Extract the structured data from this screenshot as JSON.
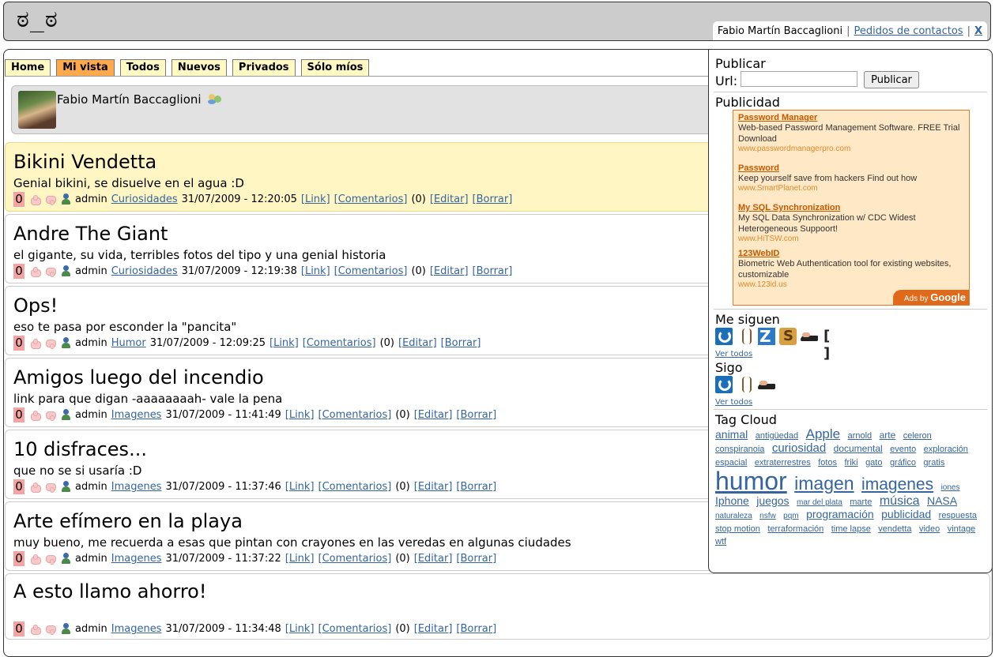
{
  "header": {
    "logo": "ಠ_ಠ",
    "user_name": "Fabio Martín Baccaglioni",
    "contacts_link": "Pedidos de contactos",
    "separator": "|",
    "close_label": "X"
  },
  "tabs": [
    {
      "label": "Home",
      "active": false
    },
    {
      "label": "Mi vista",
      "active": true
    },
    {
      "label": "Todos",
      "active": false
    },
    {
      "label": "Nuevos",
      "active": false
    },
    {
      "label": "Privados",
      "active": false
    },
    {
      "label": "Sólo míos",
      "active": false
    }
  ],
  "profile": {
    "name": "Fabio Martín Baccaglioni"
  },
  "posts": [
    {
      "title": "Bikini Vendetta",
      "desc": "Genial bikini, se disuelve en el agua :D",
      "votes": "0",
      "author": "admin",
      "category": "Curiosidades",
      "date": "31/07/2009 - 12:20:05",
      "link": "[Link]",
      "comments": "[Comentarios]",
      "count": "(0)",
      "edit": "[Editar]",
      "delete": "[Borrar]"
    },
    {
      "title": "Andre The Giant",
      "desc": "el gigante, su vida, terribles fotos del tipo y una genial historia",
      "votes": "0",
      "author": "admin",
      "category": "Curiosidades",
      "date": "31/07/2009 - 12:19:38",
      "link": "[Link]",
      "comments": "[Comentarios]",
      "count": "(0)",
      "edit": "[Editar]",
      "delete": "[Borrar]"
    },
    {
      "title": "Ops!",
      "desc": "eso te pasa por esconder la \"pancita\"",
      "votes": "0",
      "author": "admin",
      "category": "Humor",
      "date": "31/07/2009 - 12:09:25",
      "link": "[Link]",
      "comments": "[Comentarios]",
      "count": "(0)",
      "edit": "[Editar]",
      "delete": "[Borrar]"
    },
    {
      "title": "Amigos luego del incendio",
      "desc": "link para que digan -aaaaaaaah- vale la pena",
      "votes": "0",
      "author": "admin",
      "category": "Imagenes",
      "date": "31/07/2009 - 11:41:49",
      "link": "[Link]",
      "comments": "[Comentarios]",
      "count": "(0)",
      "edit": "[Editar]",
      "delete": "[Borrar]"
    },
    {
      "title": "10 disfraces...",
      "desc": "que no se si usaría :D",
      "votes": "0",
      "author": "admin",
      "category": "Imagenes",
      "date": "31/07/2009 - 11:37:46",
      "link": "[Link]",
      "comments": "[Comentarios]",
      "count": "(0)",
      "edit": "[Editar]",
      "delete": "[Borrar]"
    },
    {
      "title": "Arte efímero en la playa",
      "desc": "muy bueno, me recuerda a esas que pintan con crayones en las veredas en algunas ciudades",
      "votes": "0",
      "author": "admin",
      "category": "Imagenes",
      "date": "31/07/2009 - 11:37:22",
      "link": "[Link]",
      "comments": "[Comentarios]",
      "count": "(0)",
      "edit": "[Editar]",
      "delete": "[Borrar]"
    },
    {
      "title": "A esto llamo ahorro!",
      "desc": "",
      "votes": "0",
      "author": "admin",
      "category": "Imagenes",
      "date": "31/07/2009 - 11:34:48",
      "link": "[Link]",
      "comments": "[Comentarios]",
      "count": "(0)",
      "edit": "[Editar]",
      "delete": "[Borrar]"
    }
  ],
  "sidebar": {
    "publish_heading": "Publicar",
    "url_label": "Url:",
    "url_value": "",
    "publish_button": "Publicar",
    "ads_heading": "Publicidad",
    "ads": [
      {
        "title": "Password Manager",
        "text": "Web-based Password Management Software. FREE Trial Download",
        "url": "www.passwordmanagerpro.com"
      },
      {
        "title": "Password",
        "text": "Keep yourself save from hackers Find out how",
        "url": "www.SmartPlanet.com"
      },
      {
        "title": "My SQL Synchronization",
        "text": "My SQL Data Synchronization w/ CDC Widest Heterogeneous Suppoort!",
        "url": "www.HiTSW.com"
      },
      {
        "title": "123WebID",
        "text": "Biometric Web Authentication tool for existing websites, customizable",
        "url": "www.123id.us"
      }
    ],
    "adsby_prefix": "Ads by",
    "adsby_brand": "Google",
    "followers_heading": "Me siguen",
    "following_heading": "Sigo",
    "see_all": "Ver todos",
    "tag_heading": "Tag Cloud",
    "tags": [
      {
        "t": "animal",
        "s": 14
      },
      {
        "t": "antigüedad",
        "s": 11
      },
      {
        "t": "Apple",
        "s": 17
      },
      {
        "t": "arnold",
        "s": 11
      },
      {
        "t": "arte",
        "s": 12
      },
      {
        "t": "celeron",
        "s": 11
      },
      {
        "t": "conspiranoia",
        "s": 11
      },
      {
        "t": "curiosidad",
        "s": 15
      },
      {
        "t": "documental",
        "s": 12
      },
      {
        "t": "evento",
        "s": 11
      },
      {
        "t": "exploración",
        "s": 11
      },
      {
        "t": "espacial",
        "s": 11
      },
      {
        "t": "extraterrestres",
        "s": 11
      },
      {
        "t": "fotos",
        "s": 11
      },
      {
        "t": "friki",
        "s": 11
      },
      {
        "t": "gato",
        "s": 11
      },
      {
        "t": "gráfico",
        "s": 11
      },
      {
        "t": "gratis",
        "s": 11
      },
      {
        "t": "humor",
        "s": 32
      },
      {
        "t": "imagen",
        "s": 23
      },
      {
        "t": "imagenes",
        "s": 21
      },
      {
        "t": "iones",
        "s": 10
      },
      {
        "t": "Iphone",
        "s": 14
      },
      {
        "t": "juegos",
        "s": 14
      },
      {
        "t": "mar del plata",
        "s": 10
      },
      {
        "t": "marte",
        "s": 11
      },
      {
        "t": "música",
        "s": 16
      },
      {
        "t": "NASA",
        "s": 14
      },
      {
        "t": "naturaleza",
        "s": 10
      },
      {
        "t": "nsfw",
        "s": 10
      },
      {
        "t": "pqm",
        "s": 10
      },
      {
        "t": "programación",
        "s": 14
      },
      {
        "t": "publicidad",
        "s": 14
      },
      {
        "t": "respuesta",
        "s": 11
      },
      {
        "t": "stop motion",
        "s": 11
      },
      {
        "t": "terraformación",
        "s": 11
      },
      {
        "t": "time lapse",
        "s": 11
      },
      {
        "t": "vendetta",
        "s": 11
      },
      {
        "t": "video",
        "s": 11
      },
      {
        "t": "vintage",
        "s": 11
      },
      {
        "t": "wtf",
        "s": 11
      }
    ]
  }
}
